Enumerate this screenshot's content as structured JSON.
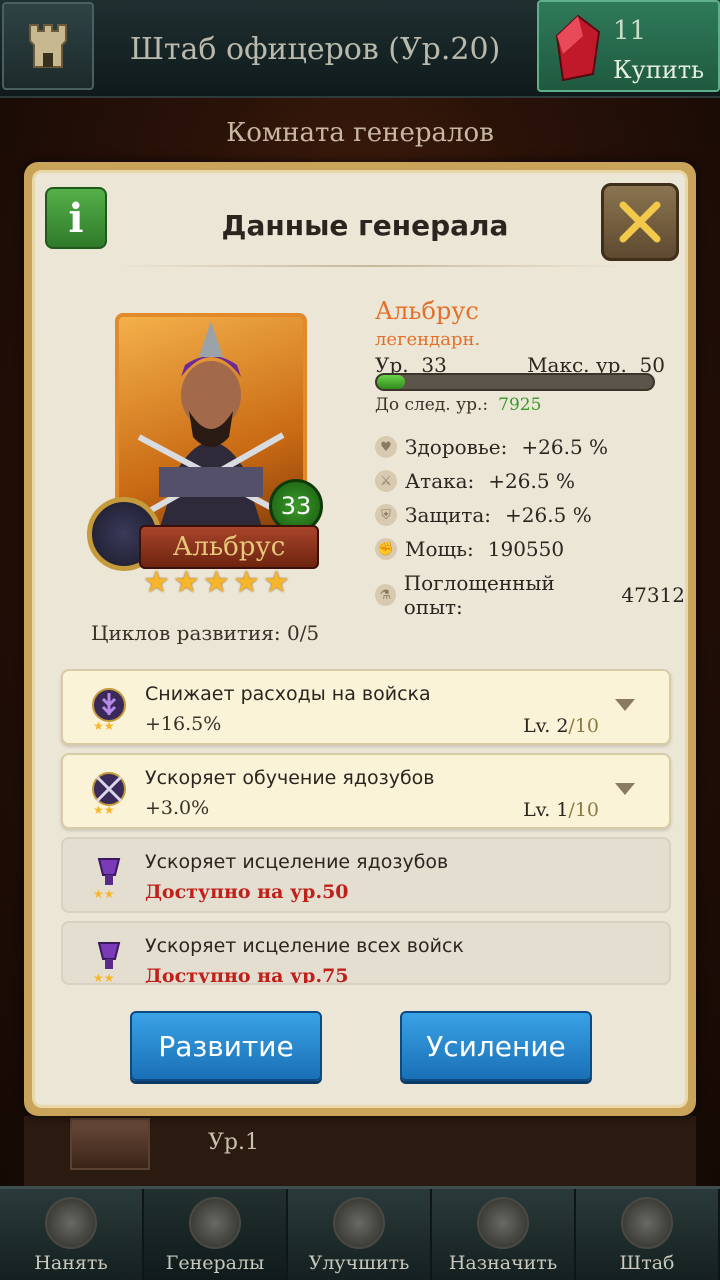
{
  "topbar": {
    "title": "Штаб офицеров (Ур.20)",
    "buy_count": "11",
    "buy_label": "Купить"
  },
  "subtitle": "Комната генералов",
  "panel": {
    "title": "Данные генерала",
    "info_label": "i"
  },
  "general": {
    "name": "Альбрус",
    "rarity": "легендарн.",
    "level_label": "Ур.",
    "level": "33",
    "max_level_label": "Макс. ур.",
    "max_level": "50",
    "progress_fraction": 0.1,
    "next_level_label": "До след. ур.:",
    "next_level_value": "7925",
    "badge_level": "33",
    "ribbon_name": "Альбрус",
    "stars": 5,
    "cycles": "Циклов развития: 0/5"
  },
  "stats": [
    {
      "icon": "heart-icon",
      "label": "Здоровье:",
      "value": "+26.5 %"
    },
    {
      "icon": "sword-icon",
      "label": "Атака:",
      "value": "+26.5 %"
    },
    {
      "icon": "shield-icon",
      "label": "Защита:",
      "value": "+26.5 %"
    },
    {
      "icon": "fist-icon",
      "label": "Мощь:",
      "value": "190550"
    },
    {
      "icon": "potion-icon",
      "label": "Поглощенный опыт:",
      "value": "47312"
    }
  ],
  "skills": [
    {
      "title": "Снижает расходы на войска",
      "value": "+16.5%",
      "lv": "Lv. 2",
      "max": "/10",
      "locked": false
    },
    {
      "title": "Ускоряет обучение ядозубов",
      "value": "+3.0%",
      "lv": "Lv. 1",
      "max": "/10",
      "locked": false
    },
    {
      "title": "Ускоряет исцеление ядозубов",
      "value": "Доступно на ур.50",
      "locked": true
    },
    {
      "title": "Ускоряет исцеление всех войск",
      "value": "Доступно на ур.75",
      "locked": true
    }
  ],
  "buttons": {
    "develop": "Развитие",
    "boost": "Усиление"
  },
  "behind": {
    "level": "Ур.1"
  },
  "nav": [
    {
      "label": "Нанять",
      "icon": "helmet-icon"
    },
    {
      "label": "Генералы",
      "icon": "generals-icon"
    },
    {
      "label": "Улучшить",
      "icon": "chevron-rank-icon"
    },
    {
      "label": "Назначить",
      "icon": "star-medal-icon"
    },
    {
      "label": "Штаб",
      "icon": "building-icon"
    }
  ],
  "colors": {
    "accent_orange": "#e2702a",
    "green_value": "#3a9a2a",
    "locked_red": "#c0201a",
    "button_blue": "#2a8ad6"
  }
}
